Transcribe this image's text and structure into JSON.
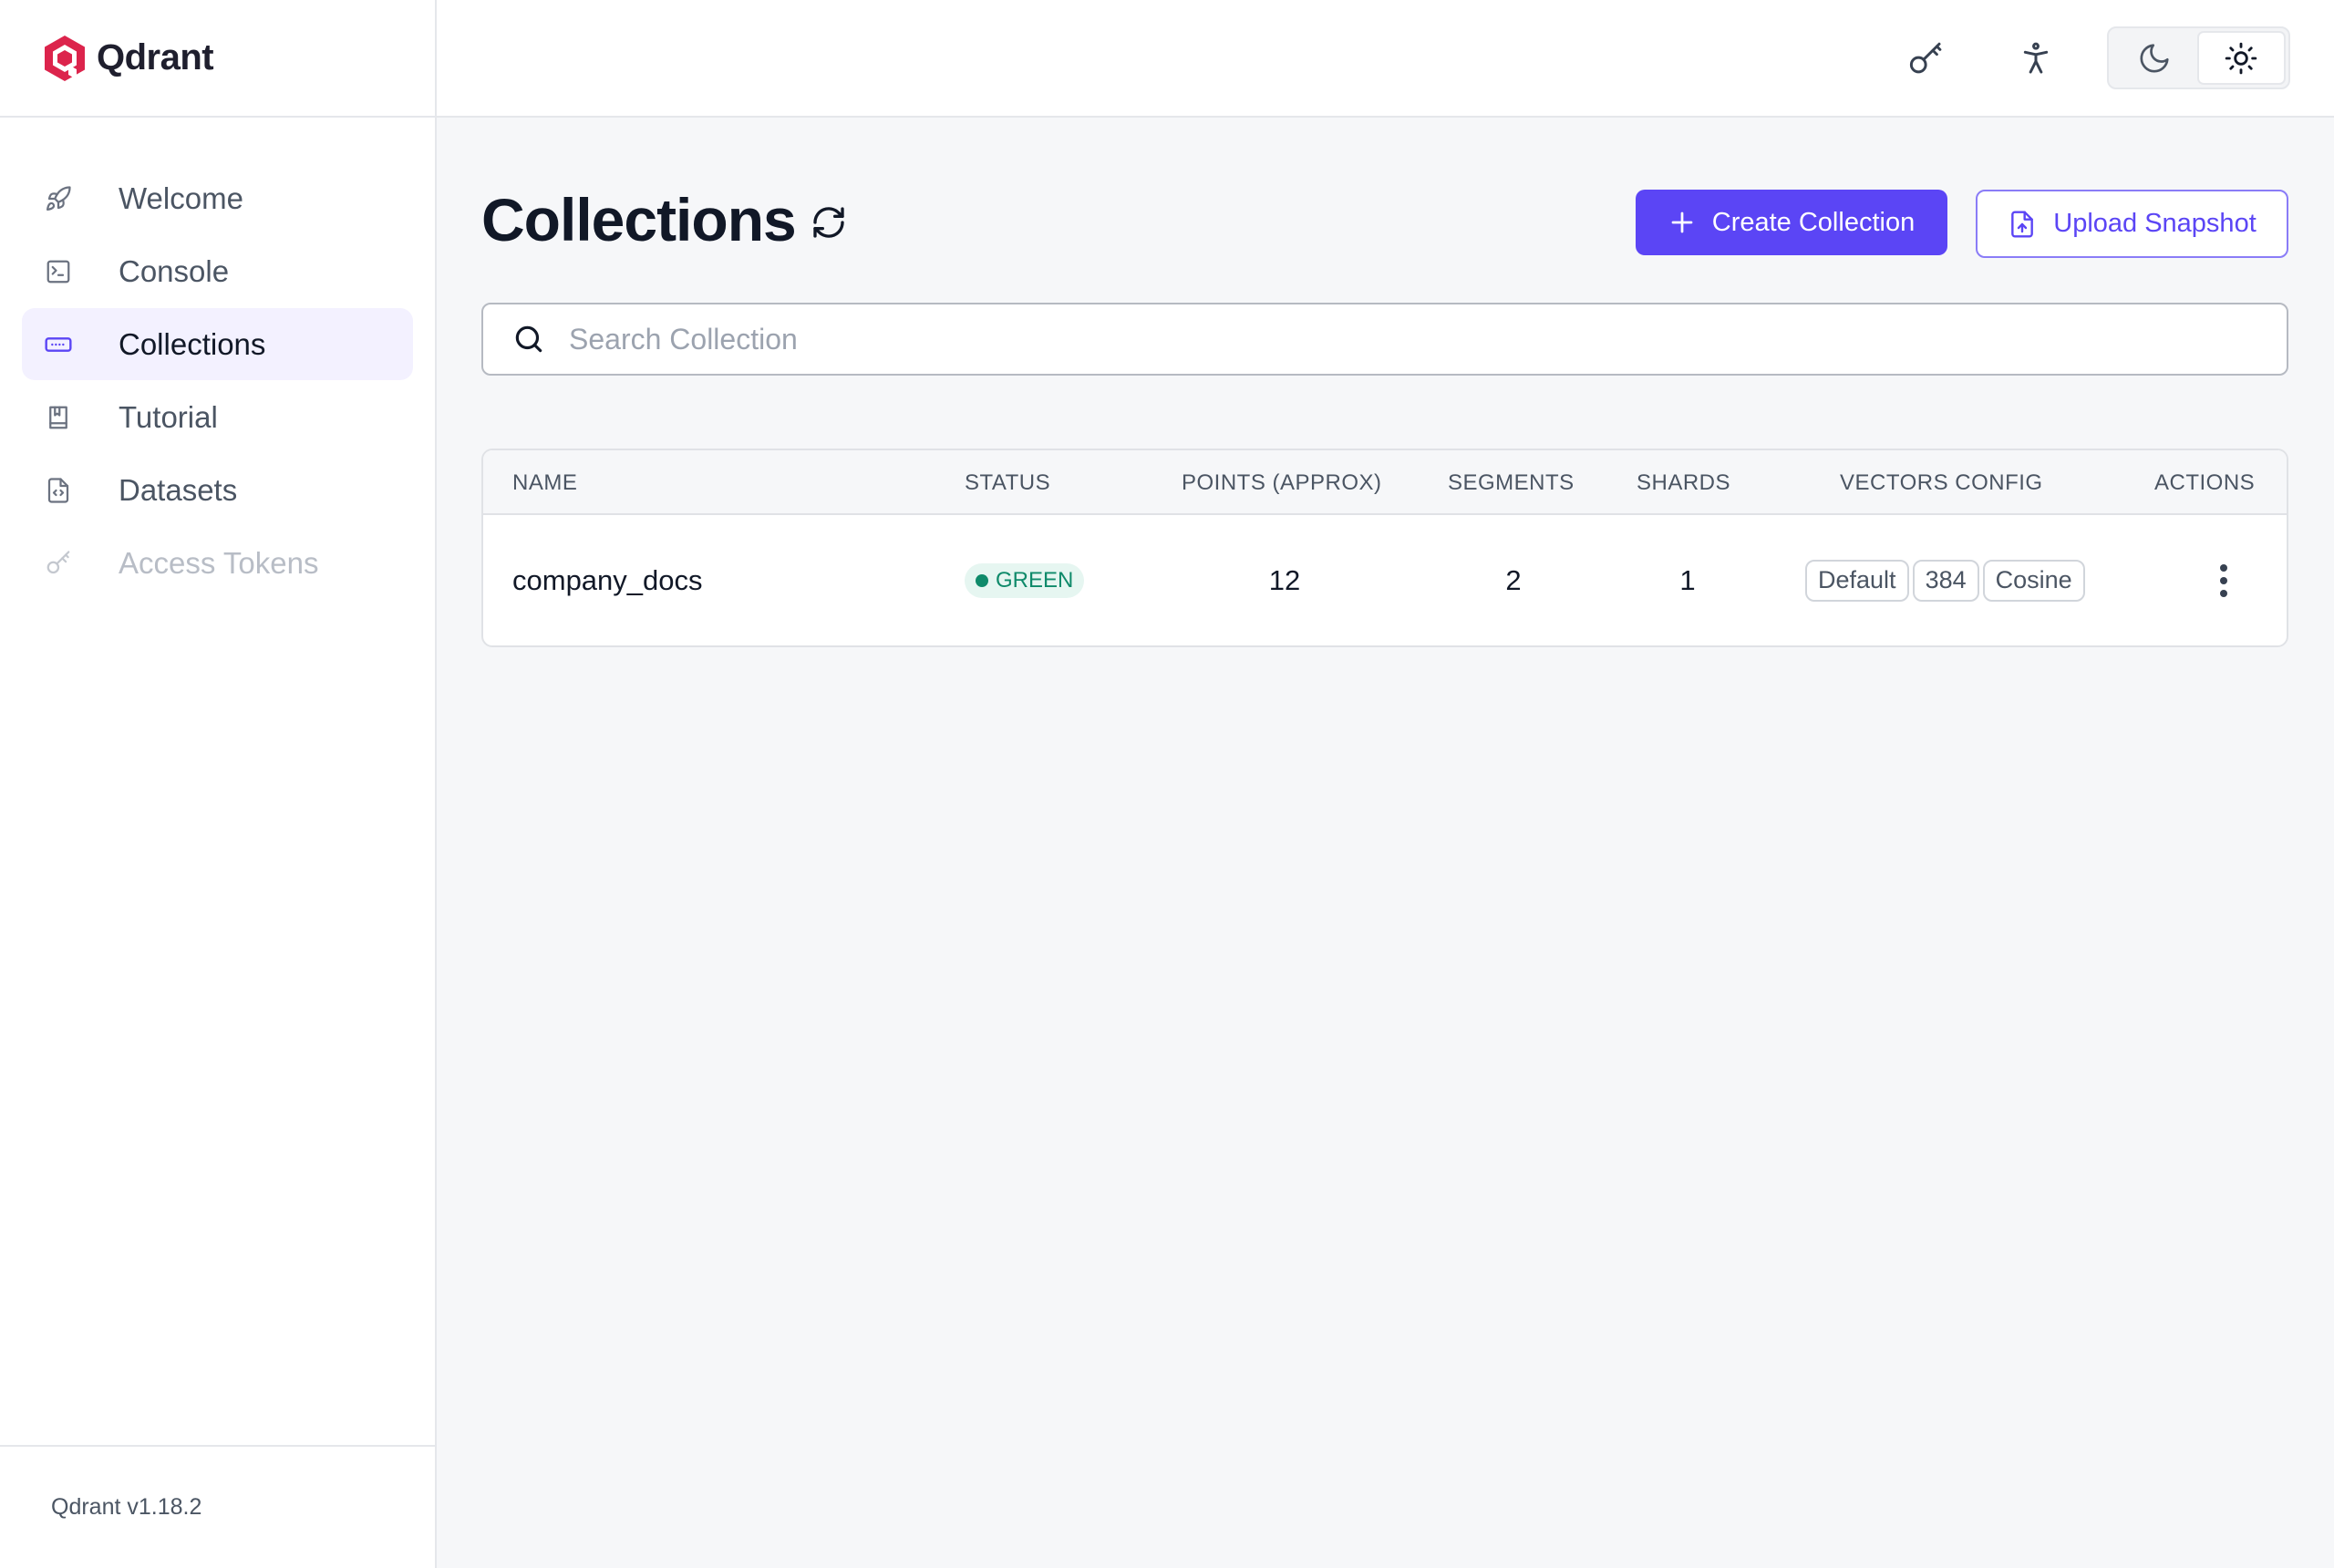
{
  "brand": {
    "name": "Qdrant"
  },
  "nav": {
    "items": [
      {
        "label": "Welcome",
        "icon": "rocket-icon"
      },
      {
        "label": "Console",
        "icon": "terminal-icon"
      },
      {
        "label": "Collections",
        "icon": "collections-icon",
        "active": true
      },
      {
        "label": "Tutorial",
        "icon": "book-icon"
      },
      {
        "label": "Datasets",
        "icon": "file-code-icon"
      },
      {
        "label": "Access Tokens",
        "icon": "key-icon",
        "disabled": true
      }
    ]
  },
  "footer": {
    "version": "Qdrant v1.18.2"
  },
  "topbar": {
    "icons": [
      "key-icon",
      "accessibility-icon"
    ],
    "theme": {
      "modes": [
        "dark",
        "light"
      ],
      "selected": "light"
    }
  },
  "main": {
    "title": "Collections",
    "create_label": "Create Collection",
    "upload_label": "Upload Snapshot",
    "search_placeholder": "Search Collection",
    "search_value": ""
  },
  "table": {
    "headers": [
      "NAME",
      "STATUS",
      "POINTS (APPROX)",
      "SEGMENTS",
      "SHARDS",
      "VECTORS CONFIG",
      "ACTIONS"
    ],
    "rows": [
      {
        "name": "company_docs",
        "status": "GREEN",
        "points": "12",
        "segments": "2",
        "shards": "1",
        "vectors": [
          "Default",
          "384",
          "Cosine"
        ]
      }
    ]
  },
  "colors": {
    "accent": "#5b45f5",
    "status_green": "#0f8a6a",
    "brand_red": "#dc244c"
  }
}
